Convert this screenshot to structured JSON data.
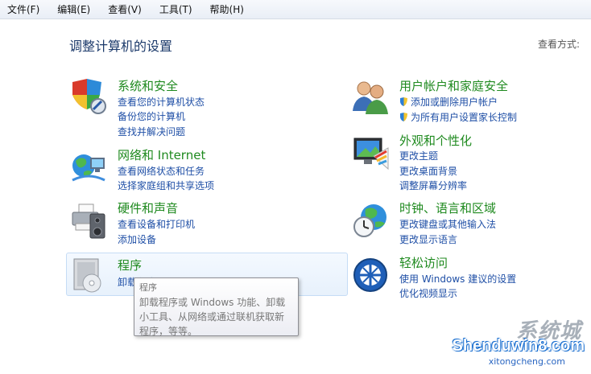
{
  "menubar": {
    "items": [
      {
        "label": "文件(F)"
      },
      {
        "label": "编辑(E)"
      },
      {
        "label": "查看(V)"
      },
      {
        "label": "工具(T)"
      },
      {
        "label": "帮助(H)"
      }
    ]
  },
  "header": {
    "title": "调整计算机的设置",
    "view_label": "查看方式:"
  },
  "categories": {
    "system_security": {
      "title": "系统和安全",
      "links": [
        "查看您的计算机状态",
        "备份您的计算机",
        "查找并解决问题"
      ]
    },
    "network": {
      "title": "网络和 Internet",
      "links": [
        "查看网络状态和任务",
        "选择家庭组和共享选项"
      ]
    },
    "hardware": {
      "title": "硬件和声音",
      "links": [
        "查看设备和打印机",
        "添加设备"
      ]
    },
    "programs": {
      "title": "程序",
      "links": [
        "卸载程序"
      ]
    },
    "user_accounts": {
      "title": "用户帐户和家庭安全",
      "links": [
        "添加或删除用户帐户",
        "为所有用户设置家长控制"
      ]
    },
    "appearance": {
      "title": "外观和个性化",
      "links": [
        "更改主题",
        "更改桌面背景",
        "调整屏幕分辨率"
      ]
    },
    "clock": {
      "title": "时钟、语言和区域",
      "links": [
        "更改键盘或其他输入法",
        "更改显示语言"
      ]
    },
    "ease": {
      "title": "轻松访问",
      "links": [
        "使用 Windows 建议的设置",
        "优化视频显示"
      ]
    }
  },
  "tooltip": {
    "title": "程序",
    "text": "卸载程序或 Windows 功能、卸载小工具、从网络或通过联机获取新程序，等等。"
  },
  "watermark": {
    "brand": "系统城",
    "site": "Shenduwin8.com",
    "sub": "xitongcheng.com"
  }
}
